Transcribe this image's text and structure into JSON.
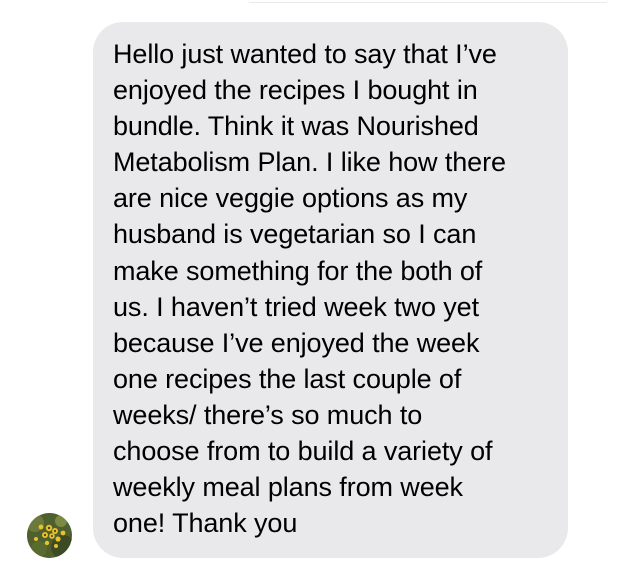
{
  "thread": {
    "incoming_message": {
      "text": "Hello just wanted to say that I’ve\nenjoyed the recipes I bought in\nbundle. Think it was Nourished\nMetabolism Plan. I like how there\nare nice veggie options as my\nhusband is vegetarian so I can\nmake something for the both of\nus. I haven’t tried week two yet\nbecause I’ve enjoyed the week\none recipes the last couple of\nweeks/ there’s so much to\nchoose from to build a variety of\nweekly meal plans from week\none! Thank you",
      "bubble_color": "#e9e9eb",
      "text_color": "#000000"
    },
    "sender": {
      "avatar_icon": "flower-photo-avatar"
    }
  }
}
